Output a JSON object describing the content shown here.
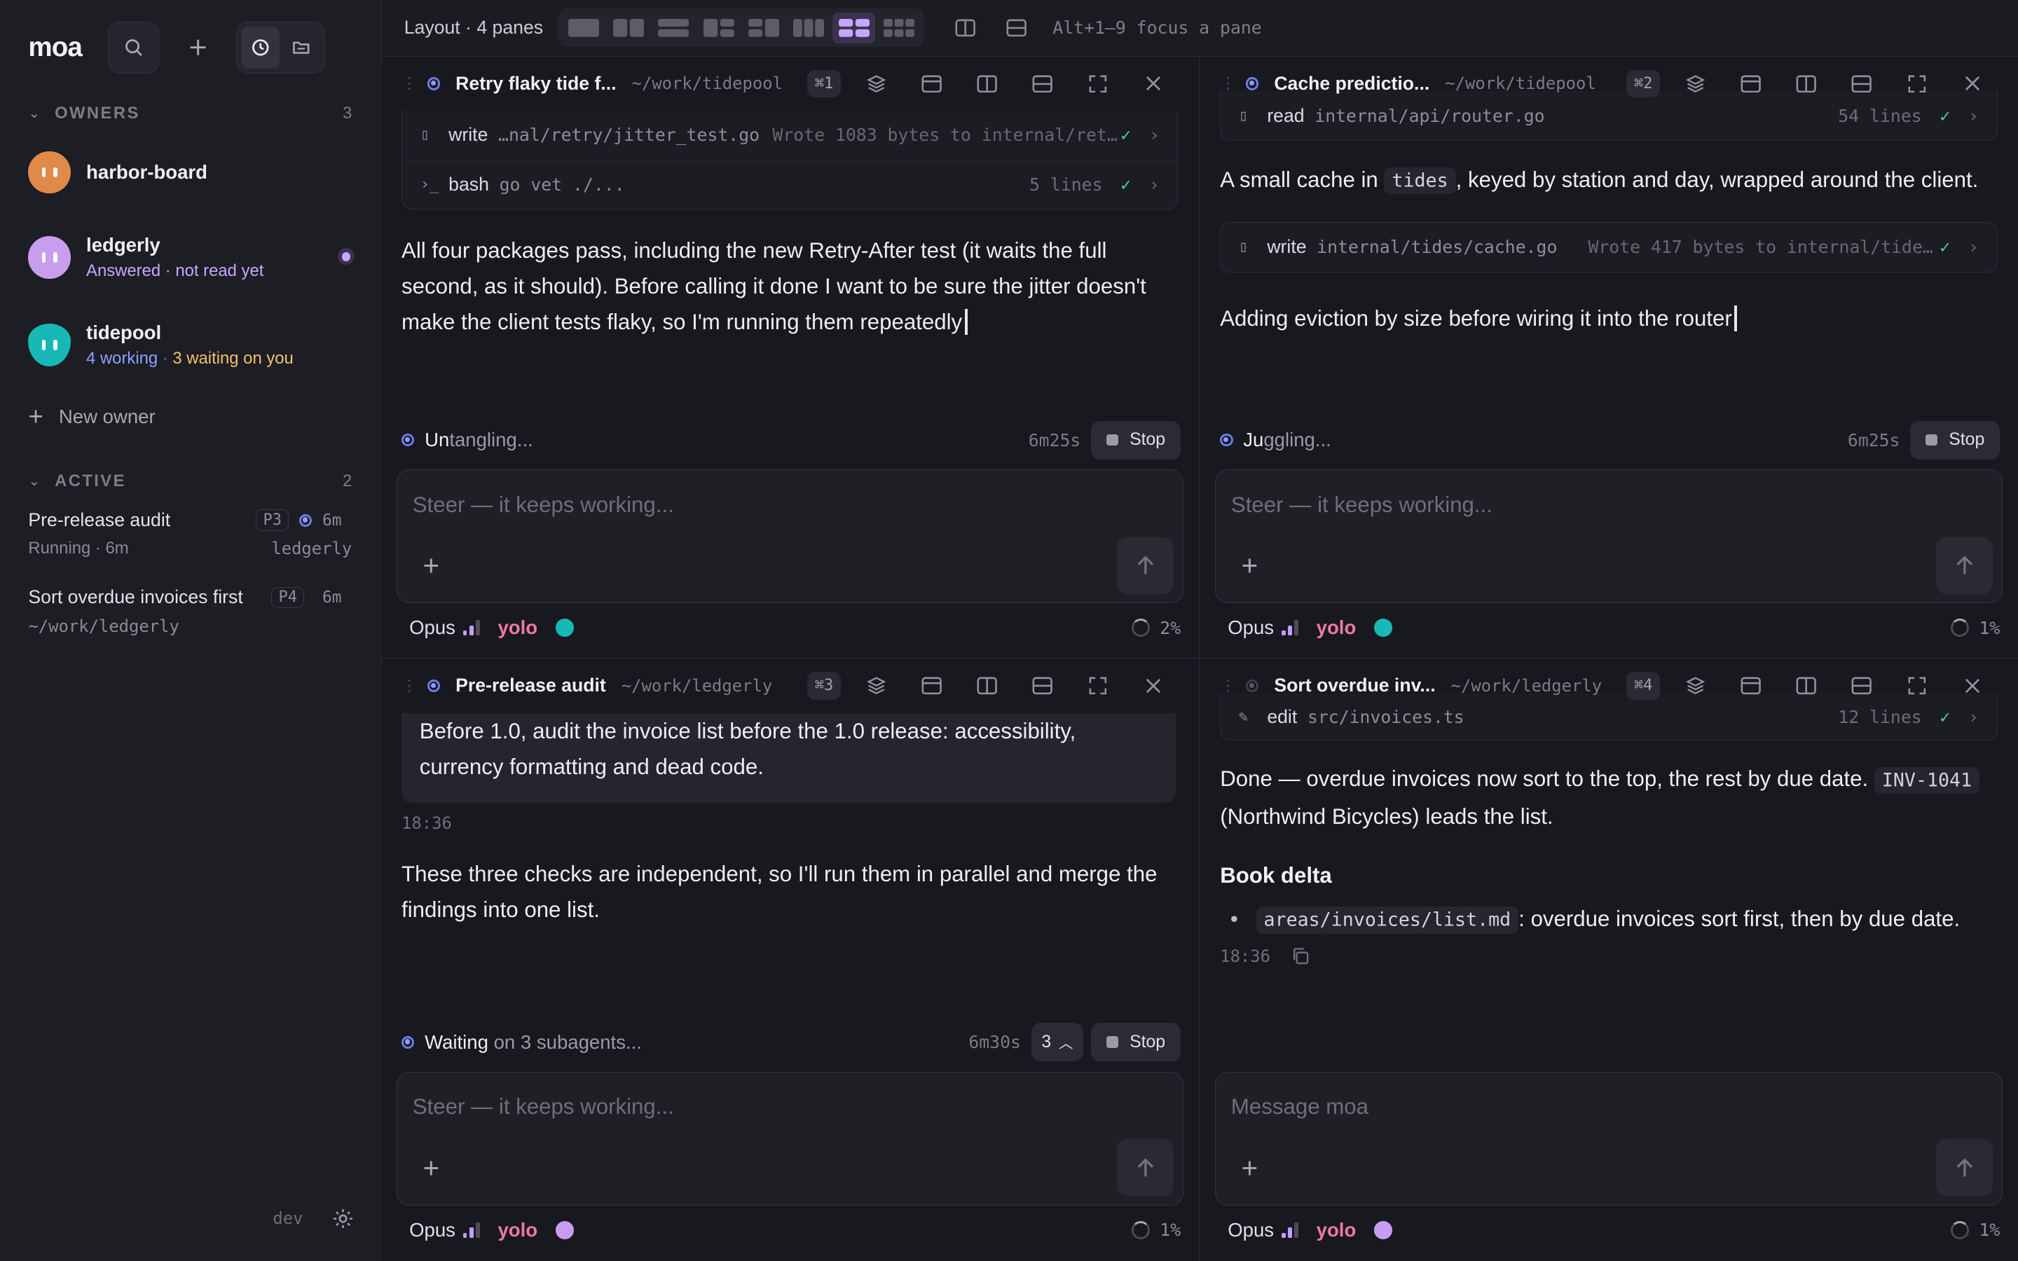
{
  "app": {
    "logo": "moa"
  },
  "sidebar": {
    "owners_title": "OWNERS",
    "owners_count": "3",
    "owners": [
      {
        "name": "harbor-board",
        "avatar_color": "#e08a4a"
      },
      {
        "name": "ledgerly",
        "sub": "Answered · not read yet",
        "avatar_color": "#c89df0"
      },
      {
        "name": "tidepool",
        "sub_working": "4 working",
        "sub_waiting": "3 waiting on you",
        "avatar_color": "#16b9b5"
      }
    ],
    "new_owner": "New owner",
    "active_title": "ACTIVE",
    "active_count": "2",
    "active": [
      {
        "title": "Pre-release audit",
        "tag": "P3",
        "time": "6m",
        "status": "Running · 6m",
        "owner": "ledgerly"
      },
      {
        "title": "Sort overdue invoices first",
        "tag": "P4",
        "time": "6m",
        "path": "~/work/ledgerly"
      }
    ],
    "env": "dev"
  },
  "topbar": {
    "layout_label": "Layout · 4 panes",
    "hint": "Alt+1–9 focus a pane"
  },
  "panes": [
    {
      "title": "Retry flaky tide f...",
      "path": "~/work/tidepool",
      "kbd": "⌘1",
      "tools": [
        {
          "name": "write",
          "arg": "…nal/retry/jitter_test.go",
          "result": "Wrote 1083 bytes to internal/ret…"
        },
        {
          "name": "bash",
          "arg": "go vet ./...",
          "lines": "5 lines"
        }
      ],
      "message": "All four packages pass, including the new Retry-After test (it waits the full second, as it should). Before calling it done I want to be sure the jitter doesn't make the client tests flaky, so I'm running them repeatedly",
      "status_bold": "Un",
      "status_rest": "tangling...",
      "elapsed": "6m25s",
      "stop": "Stop",
      "placeholder": "Steer — it keeps working...",
      "model": "Opus",
      "mode": "yolo",
      "ctx": "2%"
    },
    {
      "title": "Cache predictio...",
      "path": "~/work/tidepool",
      "kbd": "⌘2",
      "tools_top": {
        "name": "read",
        "arg": "internal/api/router.go",
        "lines": "54 lines"
      },
      "message_a1": "A small cache in ",
      "message_code": "tides",
      "message_a2": ", keyed by station and day, wrapped around the client.",
      "tool2": {
        "name": "write",
        "arg": "internal/tides/cache.go",
        "result": "Wrote 417 bytes to internal/tide…"
      },
      "message_b": "Adding eviction by size before wiring it into the router",
      "status_bold": "Ju",
      "status_rest": "ggling...",
      "elapsed": "6m25s",
      "stop": "Stop",
      "placeholder": "Steer — it keeps working...",
      "model": "Opus",
      "mode": "yolo",
      "ctx": "1%"
    },
    {
      "title": "Pre-release audit",
      "path": "~/work/ledgerly",
      "kbd": "⌘3",
      "prompt": "Before 1.0, audit the invoice list before the 1.0 release: accessibility, currency formatting and dead code.",
      "time": "18:36",
      "message": "These three checks are independent, so I'll run them in parallel and merge the findings into one list.",
      "status_bold": "Waiting",
      "status_rest": " on 3 subagents...",
      "elapsed": "6m30s",
      "subagents": "3",
      "stop": "Stop",
      "placeholder": "Steer — it keeps working...",
      "model": "Opus",
      "mode": "yolo",
      "ctx": "1%"
    },
    {
      "title": "Sort overdue inv...",
      "path": "~/work/ledgerly",
      "kbd": "⌘4",
      "tools_top": {
        "name": "edit",
        "arg": "src/invoices.ts",
        "lines": "12 lines"
      },
      "message_a1": "Done — overdue invoices now sort to the top, the rest by due date. ",
      "message_code": "INV-1041",
      "message_a2": " (Northwind Bicycles) leads the list.",
      "heading": "Book delta",
      "bullet_code": "areas/invoices/list.md",
      "bullet_text": ": overdue invoices sort first, then by due date.",
      "time": "18:36",
      "placeholder": "Message moa",
      "model": "Opus",
      "mode": "yolo",
      "ctx": "1%"
    }
  ]
}
